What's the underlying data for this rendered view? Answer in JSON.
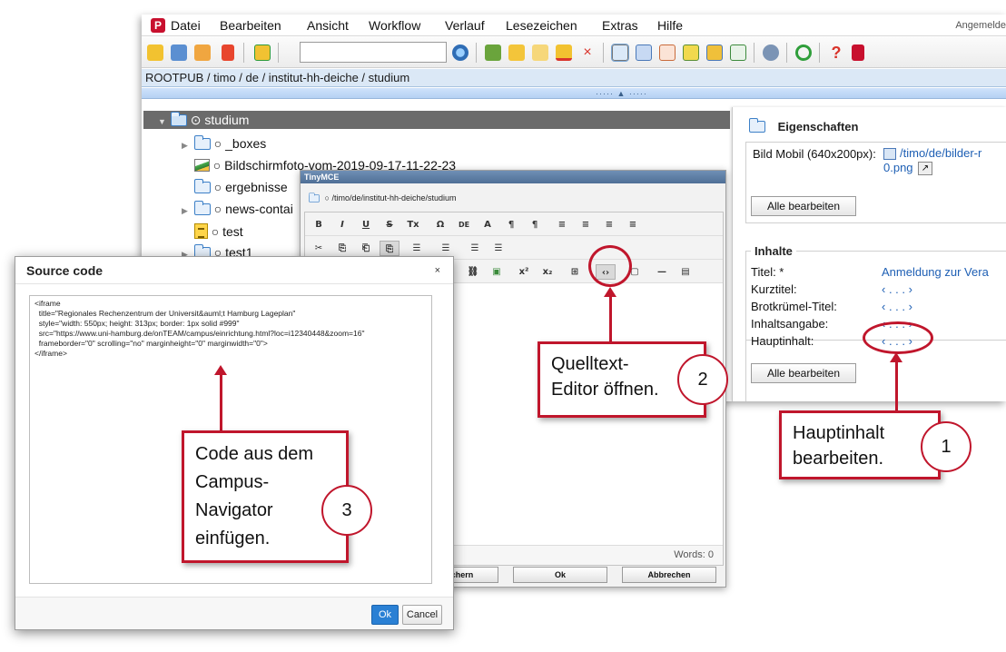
{
  "app": {
    "menu": [
      "Datei",
      "Bearbeiten",
      "Ansicht",
      "Workflow",
      "Verlauf",
      "Lesezeichen",
      "Extras",
      "Hilfe"
    ],
    "login_text": "Angemelde",
    "search_value": "",
    "breadcrumb": "ROOTPUB / timo / de / institut-hh-deiche / studium"
  },
  "tree": {
    "root": "⊙ studium",
    "items": [
      "○ _boxes",
      "○ Bildschirmfoto-vom-2019-09-17-11-22-23",
      "○ ergebnisse",
      "○ news-contai",
      "○ test",
      "○ test1"
    ]
  },
  "properties": {
    "title": "Eigenschaften",
    "bild_label": "Bild Mobil (640x200px):",
    "bild_value_line1": "/timo/de/bilder-r",
    "bild_value_line2": "0.png",
    "edit_all_1": "Alle bearbeiten",
    "contents_legend": "Inhalte",
    "fields": [
      {
        "label": "Titel: *",
        "value": "Anmeldung zur Vera"
      },
      {
        "label": "Kurztitel:",
        "value": "‹ . . . ›"
      },
      {
        "label": "Brotkrümel-Titel:",
        "value": "‹ . . . ›"
      },
      {
        "label": "Inhaltsangabe:",
        "value": "‹ . . . ›"
      },
      {
        "label": "Hauptinhalt:",
        "value": "‹ . . . ›"
      }
    ],
    "edit_all_2": "Alle bearbeiten"
  },
  "tinymce": {
    "title": "TinyMCE",
    "path": "○ /timo/de/institut-hh-deiche/studium",
    "row1": [
      "B",
      "I",
      "U",
      "S",
      "Tx",
      "Ω",
      "DE",
      "A",
      "¶",
      "¶",
      "≡",
      "≡",
      "≡",
      "≡"
    ],
    "row2": [
      "✂",
      "⎘",
      "⎗",
      "⎘",
      "☰",
      "☰",
      "☰",
      "☰"
    ],
    "row3": [
      "⛓",
      "▣",
      "x²",
      "x₂",
      "⊞",
      "‹›",
      "▢",
      "—",
      "▤"
    ],
    "words": "Words: 0",
    "save_label": "chern",
    "ok_label": "Ok",
    "cancel_label": "Abbrechen"
  },
  "source_dialog": {
    "title": "Source code",
    "close": "×",
    "code": "<iframe\n  title=\"Regionales Rechenzentrum der Universit&auml;t Hamburg Lageplan\"\n  style=\"width: 550px; height: 313px; border: 1px solid #999\"\n  src=\"https://www.uni-hamburg.de/onTEAM/campus/einrichtung.html?loc=i12340448&zoom=16\"\n  frameborder=\"0\" scrolling=\"no\" marginheight=\"0\" marginwidth=\"0\">\n</iframe>",
    "ok": "Ok",
    "cancel": "Cancel"
  },
  "callouts": {
    "one_text": "Hauptinhalt\nbearbeiten.",
    "one_num": "1",
    "two_text": "Quelltext-\nEditor öffnen.",
    "two_num": "2",
    "three_text": "Code aus dem\nCampus-\nNavigator\neinfügen.",
    "three_num": "3"
  },
  "colors": {
    "accent_red": "#c0162c",
    "breadcrumb_bg": "#dbe8f6",
    "link_blue": "#1e5fb4",
    "ok_blue": "#2a80d4"
  }
}
